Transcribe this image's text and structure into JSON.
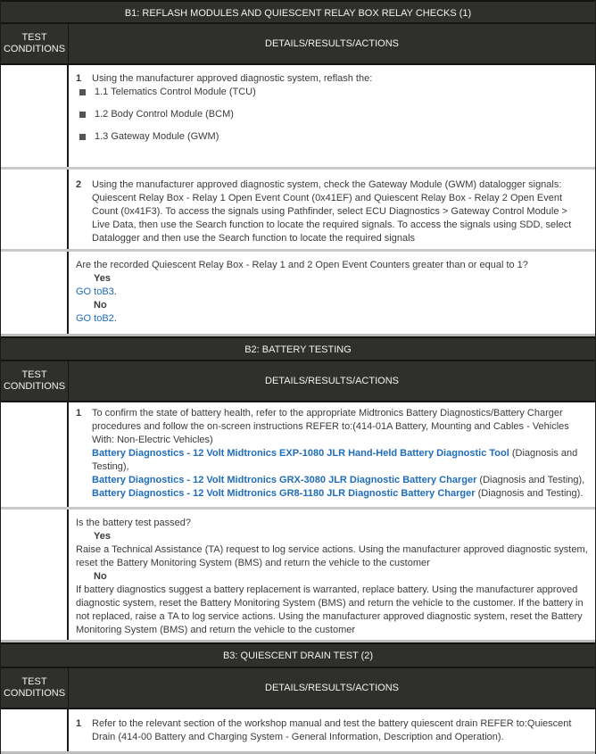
{
  "column_headers": {
    "test_conditions": "TEST CONDITIONS",
    "details": "DETAILS/RESULTS/ACTIONS"
  },
  "b1": {
    "title": "B1: REFLASH MODULES AND QUIESCENT RELAY BOX RELAY CHECKS (1)",
    "step1": {
      "num": "1",
      "text": "Using the manufacturer approved diagnostic system, reflash the:",
      "items": [
        "1.1 Telematics Control Module (TCU)",
        "1.2 Body Control Module (BCM)",
        "1.3 Gateway Module (GWM)"
      ]
    },
    "step2": {
      "num": "2",
      "text": "Using the manufacturer approved diagnostic system, check the Gateway Module (GWM) datalogger signals: Quiescent Relay Box - Relay 1 Open Event Count (0x41EF) and Quiescent Relay Box - Relay 2 Open Event Count (0x41F3). To access the signals using Pathfinder, select ECU Diagnostics > Gateway Control Module > Live Data, then use the Search function to locate the required signals. To access the signals using SDD, select Datalogger and then use the Search function to locate the required signals"
    },
    "question": "Are the recorded Quiescent Relay Box - Relay 1 and 2 Open Event Counters greater than or equal to 1?",
    "yes_label": "Yes",
    "yes_link": "GO toB3",
    "no_label": "No",
    "no_link": "GO toB2",
    "period": "."
  },
  "b2": {
    "title": "B2: BATTERY TESTING",
    "step1": {
      "num": "1",
      "text": "To confirm the state of battery health, refer to the appropriate Midtronics Battery Diagnostics/Battery Charger procedures and follow the on-screen instructions REFER to:(414-01A Battery, Mounting and Cables - Vehicles With: Non-Electric Vehicles)",
      "links": [
        {
          "label": "Battery Diagnostics - 12 Volt Midtronics EXP-1080 JLR Hand-Held Battery Diagnostic Tool",
          "suffix": " (Diagnosis and Testing),"
        },
        {
          "label": "Battery Diagnostics - 12 Volt Midtronics GRX-3080 JLR Diagnostic Battery Charger",
          "suffix": " (Diagnosis and Testing),"
        },
        {
          "label": "Battery Diagnostics - 12 Volt Midtronics GR8-1180 JLR Diagnostic Battery Charger",
          "suffix": " (Diagnosis and Testing)."
        }
      ]
    },
    "question": "Is the battery test passed?",
    "yes_label": "Yes",
    "yes_text": "Raise a Technical Assistance (TA) request to log service actions. Using the manufacturer approved diagnostic system, reset the Battery Monitoring System (BMS) and return the vehicle to the customer",
    "no_label": "No",
    "no_text": "If battery diagnostics suggest a battery replacement is warranted, replace battery. Using the manufacturer approved diagnostic system, reset the Battery Monitoring System (BMS) and return the vehicle to the customer. If the battery in not replaced, raise a TA to log service actions. Using the manufacturer approved diagnostic system, reset the Battery Monitoring System (BMS) and return the vehicle to the customer"
  },
  "b3": {
    "title": "B3: QUIESCENT DRAIN TEST (2)",
    "step1": {
      "num": "1",
      "text": "Refer to the relevant section of the workshop manual and test the battery quiescent drain REFER to:Quiescent Drain (414-00 Battery and Charging System - General Information, Description and Operation)."
    }
  },
  "colors": {
    "header_bg": "#2f302b",
    "header_text": "#f2f2f2",
    "link": "#1f6db8",
    "body_text": "#3a3a3a"
  }
}
